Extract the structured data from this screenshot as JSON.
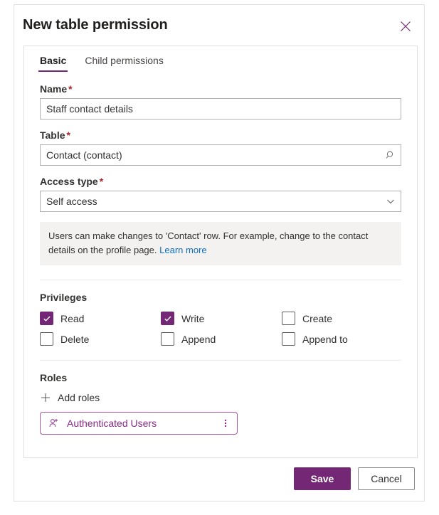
{
  "panel": {
    "title": "New table permission",
    "close_icon": "close-icon"
  },
  "tabs": [
    {
      "label": "Basic",
      "selected": true
    },
    {
      "label": "Child permissions",
      "selected": false
    }
  ],
  "fields": {
    "name": {
      "label": "Name",
      "required_marker": "*",
      "value": "Staff contact details",
      "placeholder": ""
    },
    "table": {
      "label": "Table",
      "required_marker": "*",
      "value": "Contact (contact)",
      "placeholder": "",
      "icon": "search-icon"
    },
    "access_type": {
      "label": "Access type",
      "required_marker": "*",
      "value": "Self access",
      "icon": "chevron-down-icon"
    }
  },
  "info": {
    "text": "Users can make changes to 'Contact' row. For example, change to the contact details on the profile page.",
    "link_label": "Learn more"
  },
  "privileges": {
    "title": "Privileges",
    "items": [
      {
        "label": "Read",
        "checked": true
      },
      {
        "label": "Write",
        "checked": true
      },
      {
        "label": "Create",
        "checked": false
      },
      {
        "label": "Delete",
        "checked": false
      },
      {
        "label": "Append",
        "checked": false
      },
      {
        "label": "Append to",
        "checked": false
      }
    ]
  },
  "roles": {
    "title": "Roles",
    "add_label": "Add roles",
    "add_icon": "plus-icon",
    "chips": [
      {
        "label": "Authenticated Users",
        "icon": "person-add-icon",
        "menu_icon": "more-vertical-icon"
      }
    ]
  },
  "footer": {
    "save_label": "Save",
    "cancel_label": "Cancel"
  },
  "colors": {
    "accent": "#742774",
    "chip_border": "#a9559f",
    "chip_text": "#8a2b8a",
    "link": "#0f6cbd",
    "required": "#a4262c",
    "info_bg": "#f3f2f1"
  }
}
